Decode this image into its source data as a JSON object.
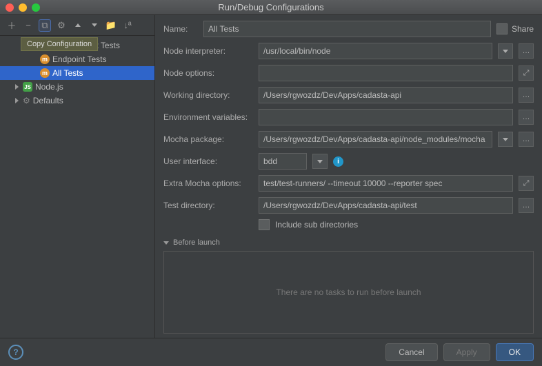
{
  "window": {
    "title": "Run/Debug Configurations"
  },
  "tooltip": "Copy Configuration",
  "tree": {
    "mocha": [
      "Regular Unit Tests",
      "Endpoint Tests",
      "All Tests"
    ],
    "selected": "All Tests",
    "nodejs": "Node.js",
    "defaults": "Defaults"
  },
  "form": {
    "name_label": "Name:",
    "name_value": "All Tests",
    "share_label": "Share",
    "node_interpreter_label": "Node interpreter:",
    "node_interpreter_value": "/usr/local/bin/node",
    "node_options_label": "Node options:",
    "node_options_value": "",
    "working_dir_label": "Working directory:",
    "working_dir_value": "/Users/rgwozdz/DevApps/cadasta-api",
    "env_vars_label": "Environment variables:",
    "env_vars_value": "",
    "mocha_pkg_label": "Mocha package:",
    "mocha_pkg_value": "/Users/rgwozdz/DevApps/cadasta-api/node_modules/mocha",
    "ui_label": "User interface:",
    "ui_value": "bdd",
    "extra_label": "Extra Mocha options:",
    "extra_value": "test/test-runners/ --timeout 10000 --reporter spec",
    "test_dir_label": "Test directory:",
    "test_dir_value": "/Users/rgwozdz/DevApps/cadasta-api/test",
    "include_sub_label": "Include sub directories"
  },
  "before": {
    "header": "Before launch",
    "empty": "There are no tasks to run before launch"
  },
  "footer": {
    "cancel": "Cancel",
    "apply": "Apply",
    "ok": "OK"
  }
}
